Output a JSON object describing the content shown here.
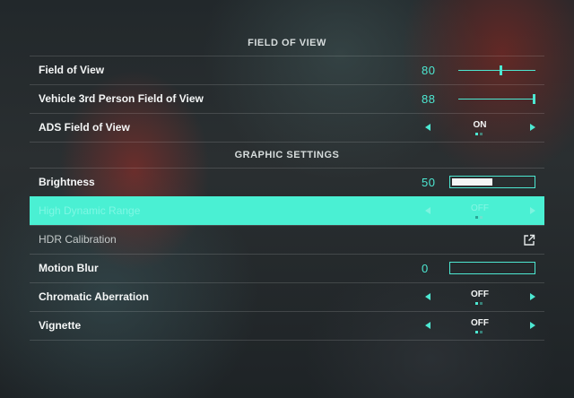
{
  "sections": {
    "fov": {
      "title": "FIELD OF VIEW"
    },
    "graphics": {
      "title": "GRAPHIC SETTINGS"
    }
  },
  "rows": {
    "fov": {
      "label": "Field of View",
      "value": "80",
      "slider_fraction": 0.55
    },
    "vehicle_fov": {
      "label": "Vehicle 3rd Person Field of View",
      "value": "88",
      "slider_fraction": 1.0
    },
    "ads_fov": {
      "label": "ADS Field of View",
      "value": "ON",
      "selected_index": 0
    },
    "brightness": {
      "label": "Brightness",
      "value": "50",
      "fill_fraction": 0.5
    },
    "hdr": {
      "label": "High Dynamic Range",
      "value": "OFF",
      "selected_index": 0,
      "highlighted": true
    },
    "hdr_calibration": {
      "label": "HDR Calibration",
      "icon": "external-link-icon"
    },
    "motion_blur": {
      "label": "Motion Blur",
      "value": "0",
      "fill_fraction": 0.0
    },
    "chromatic_aberration": {
      "label": "Chromatic Aberration",
      "value": "OFF",
      "selected_index": 0
    },
    "vignette": {
      "label": "Vignette",
      "value": "OFF",
      "selected_index": 0
    }
  },
  "colors": {
    "accent": "#4de8d2",
    "highlight_row": "#4af0d3",
    "text": "#f4f6f6"
  }
}
